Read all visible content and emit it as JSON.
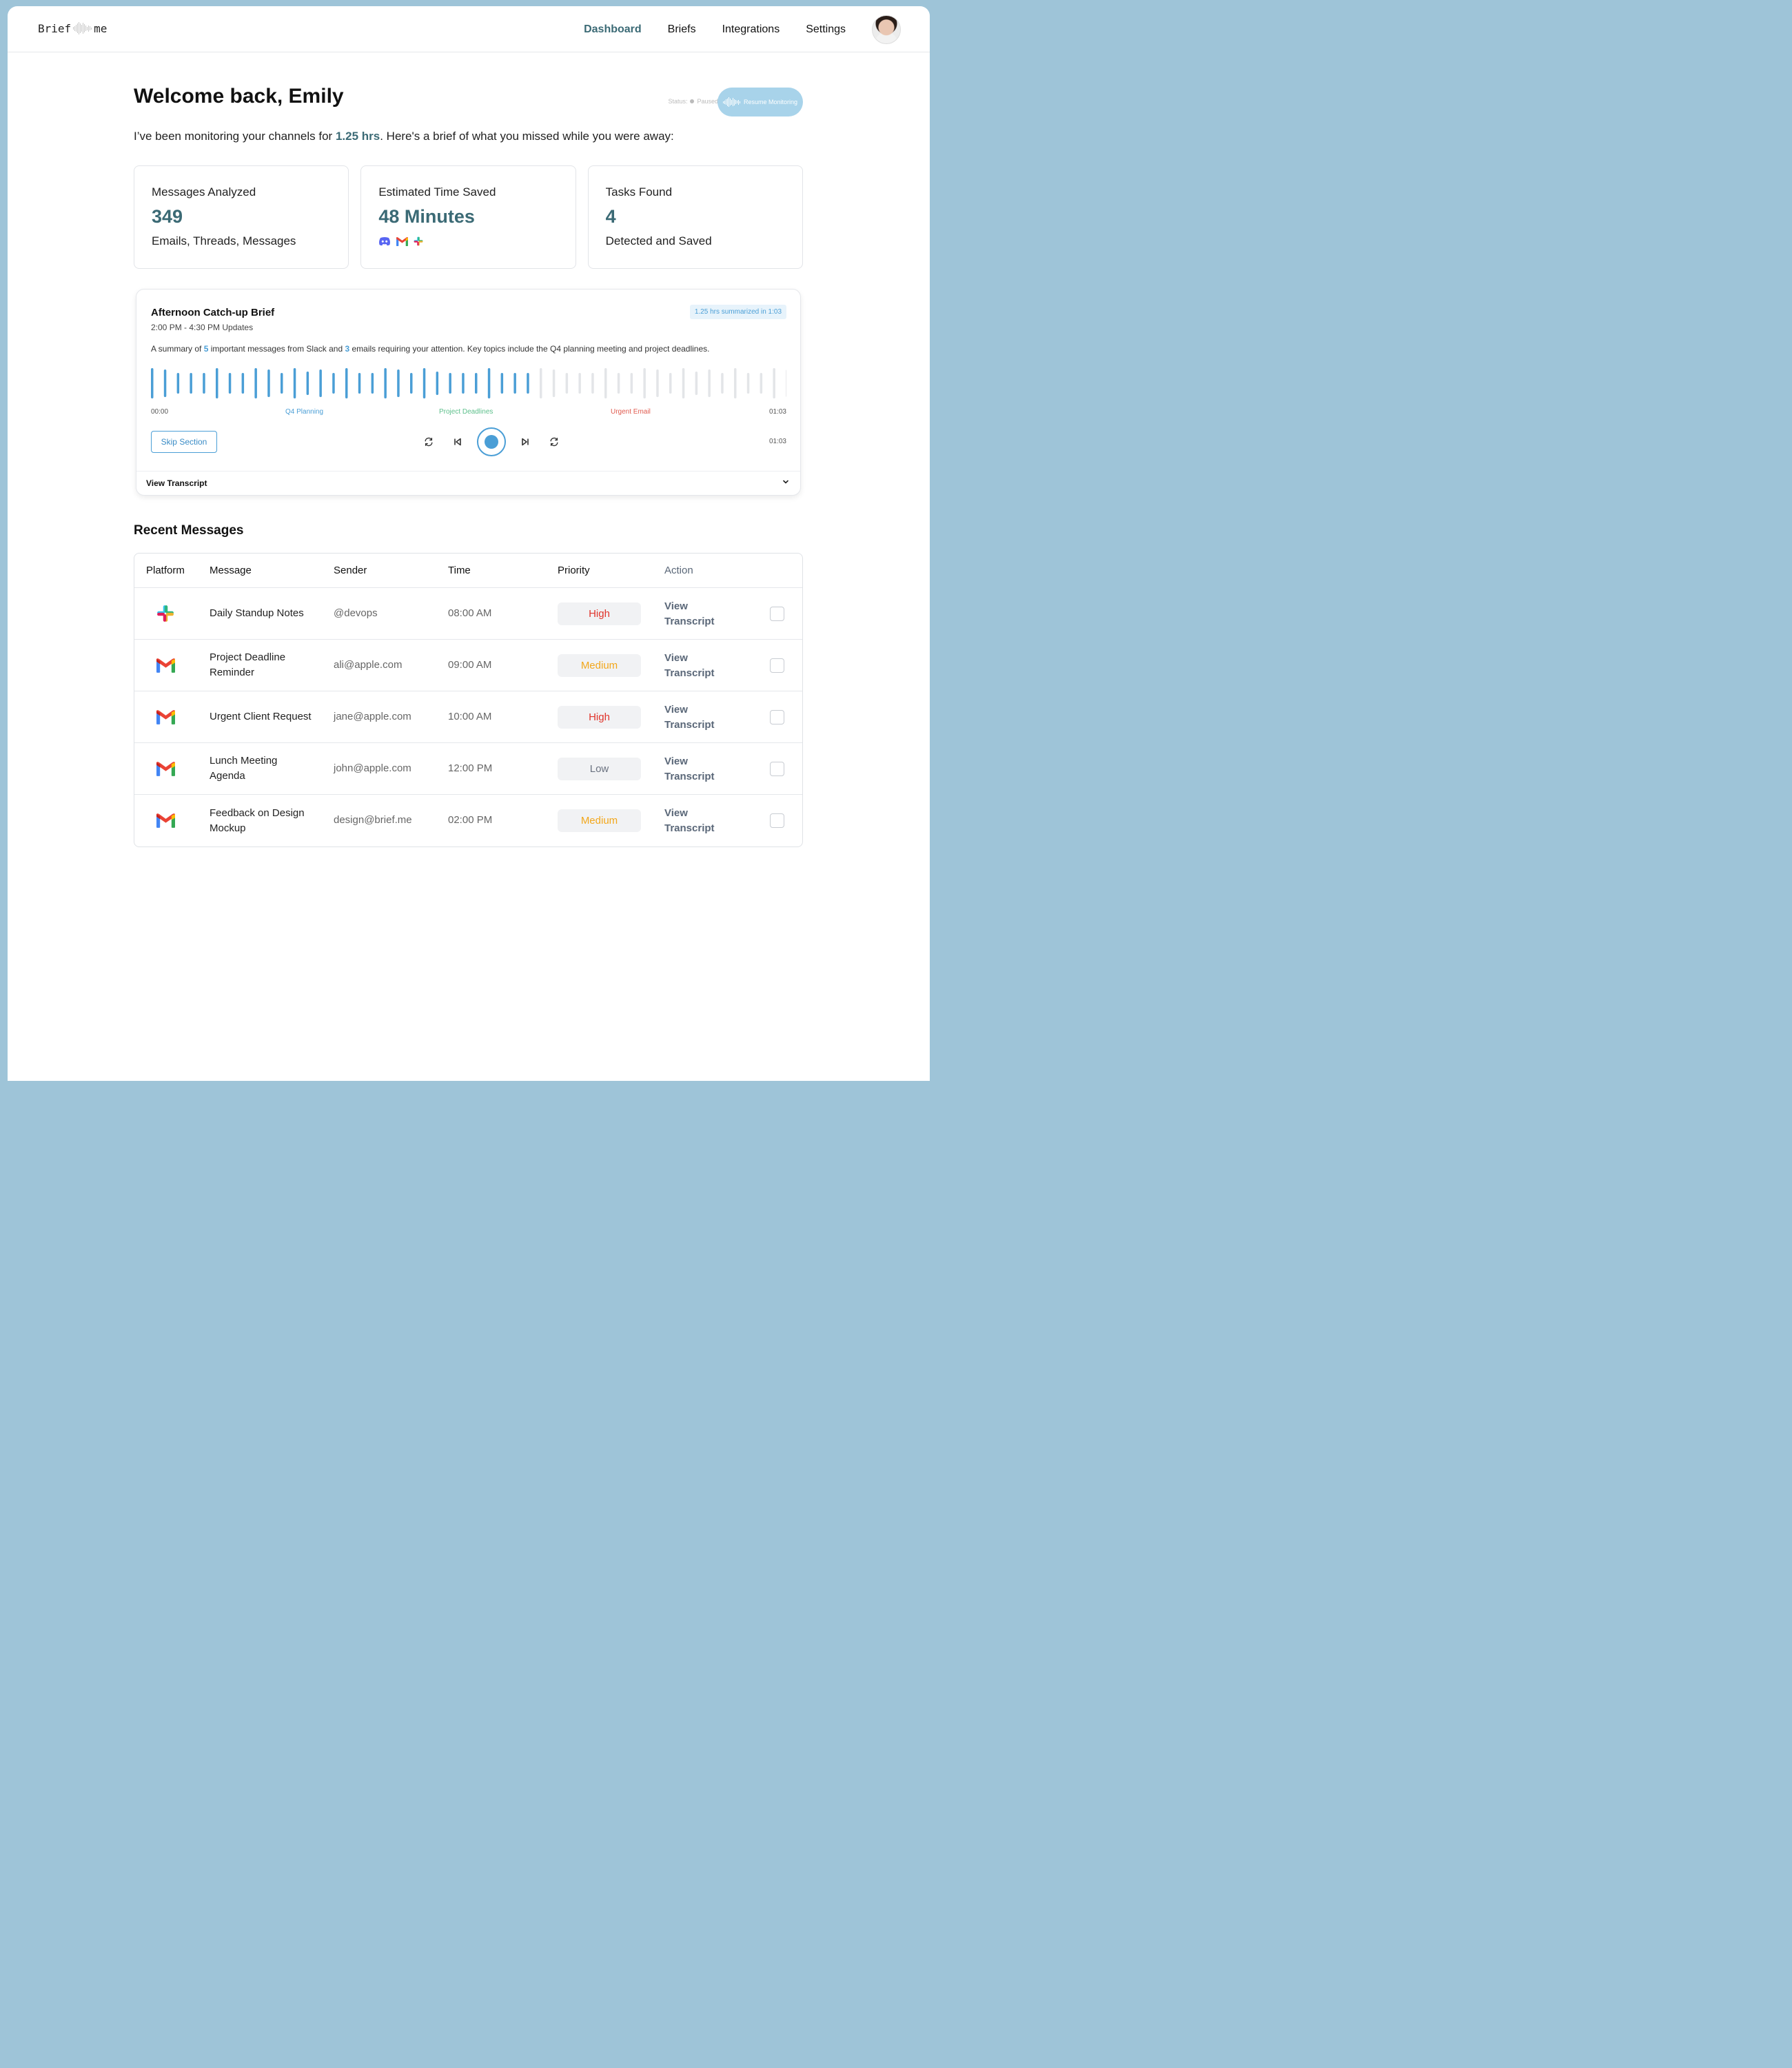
{
  "brand": {
    "logo_left": "Brief",
    "logo_right": "me"
  },
  "nav": {
    "items": [
      {
        "label": "Dashboard",
        "active": true
      },
      {
        "label": "Briefs"
      },
      {
        "label": "Integrations"
      },
      {
        "label": "Settings"
      }
    ],
    "avatar": "user-avatar"
  },
  "header": {
    "welcome": "Welcome back, Emily",
    "status_label": "Status:",
    "status_value": "Paused",
    "resume_button": "Resume Monitoring",
    "intro_before": "I’ve been monitoring your channels for ",
    "intro_highlight": "1.25 hrs",
    "intro_after": ". Here's a brief of what you missed while you were away:"
  },
  "stats": [
    {
      "title": "Messages Analyzed",
      "value": "349",
      "sub": "Emails, Threads, Messages"
    },
    {
      "title": "Estimated Time Saved",
      "value": "48 Minutes",
      "icons": [
        "discord-icon",
        "gmail-icon",
        "slack-icon"
      ]
    },
    {
      "title": "Tasks Found",
      "value": "4",
      "sub": "Detected and Saved"
    }
  ],
  "brief": {
    "title": "Afternoon Catch-up Brief",
    "subtitle": "2:00 PM - 4:30 PM Updates",
    "badge": "1.25 hrs summarized in 1:03",
    "summary_a": "A summary of ",
    "summary_n1": "5",
    "summary_b": " important messages from Slack and ",
    "summary_n2": "3",
    "summary_c": " emails requiring your attention. Key topics include the Q4 planning meeting and project deadlines.",
    "progress": 0.6,
    "timeline": {
      "start": "00:00",
      "end": "01:03",
      "markers": [
        {
          "label": "Q4 Planning",
          "color": "#4a9ed6"
        },
        {
          "label": "Project Deadlines",
          "color": "#5bbf8a"
        },
        {
          "label": "Urgent Email",
          "color": "#e05a4e"
        }
      ]
    },
    "skip_button": "Skip Section",
    "end_time": "01:03",
    "view_transcript": "View Transcript"
  },
  "recent": {
    "title": "Recent Messages",
    "columns": [
      "Platform",
      "Message",
      "Sender",
      "Time",
      "Priority",
      "Action"
    ],
    "rows": [
      {
        "platform": "slack",
        "message": "Daily Standup Notes",
        "sender": "@devops",
        "time": "08:00 AM",
        "priority": "High",
        "action": "View Transcript"
      },
      {
        "platform": "gmail",
        "message": "Project Deadline Reminder",
        "sender": "ali@apple.com",
        "time": "09:00 AM",
        "priority": "Medium",
        "action": "View Transcript"
      },
      {
        "platform": "gmail",
        "message": "Urgent Client Request",
        "sender": "jane@apple.com",
        "time": "10:00 AM",
        "priority": "High",
        "action": "View Transcript"
      },
      {
        "platform": "gmail",
        "message": "Lunch Meeting Agenda",
        "sender": "john@apple.com",
        "time": "12:00 PM",
        "priority": "Low",
        "action": "View Transcript"
      },
      {
        "platform": "gmail",
        "message": "Feedback on Design Mockup",
        "sender": "design@brief.me",
        "time": "02:00 PM",
        "priority": "Medium",
        "action": "View Transcript"
      }
    ]
  },
  "colors": {
    "accent": "#3b6a75",
    "blue": "#4a9ed6",
    "high": "#e0342b",
    "medium": "#f2a71b",
    "low": "#6b7280"
  }
}
